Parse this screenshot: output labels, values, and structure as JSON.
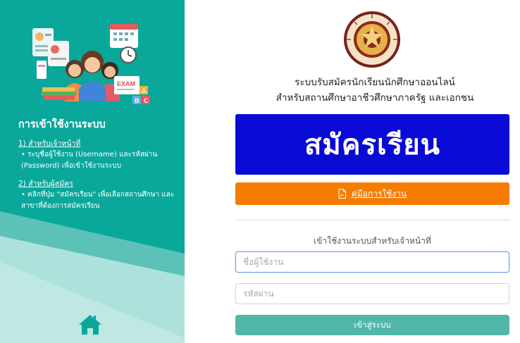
{
  "sidebar": {
    "heading": "การเข้าใช้งานระบบ",
    "section1_title": "1) สำหรับเจ้าหน้าที่",
    "section1_desc": "• ระบุชื่อผู้ใช้งาน (Username) และรหัสผ่าน (Password) เพื่อเข้าใช้งานระบบ",
    "section2_title": "2) สำหรับผู้สมัคร",
    "section2_desc": "• คลิกที่ปุ่ม \"สมัครเรียน\" เพื่อเลือกสถานศึกษา และสาขาที่ต้องการสมัครเรียน",
    "illustration_text": "EXAM",
    "abc_letters": [
      "A",
      "B",
      "C"
    ]
  },
  "header": {
    "title_line1": "ระบบรับสมัครนักเรียนนักศึกษาออนไลน์",
    "title_line2": "สำหรับสถานศึกษาอาชีวศึกษาภาครัฐ และเอกชน",
    "logo_text": "VOCATIONAL EDUCATION COMMISSION"
  },
  "actions": {
    "register_label": "สมัครเรียน",
    "manual_label": "คู่มือการใช้งาน"
  },
  "login": {
    "caption": "เข้าใช้งานระบบสำหรับเจ้าหน้าที่",
    "username_placeholder": "ชื่อผู้ใช้งาน",
    "password_placeholder": "รหัสผ่าน",
    "submit_label": "เข้าสู่ระบบ"
  },
  "colors": {
    "sidebar_bg": "#0aa79b",
    "register_bg": "#0a0ad6",
    "manual_bg": "#f57c00",
    "login_bg": "#51b7a9"
  },
  "icons": {
    "home": "home-icon",
    "pdf": "pdf-file-icon"
  }
}
